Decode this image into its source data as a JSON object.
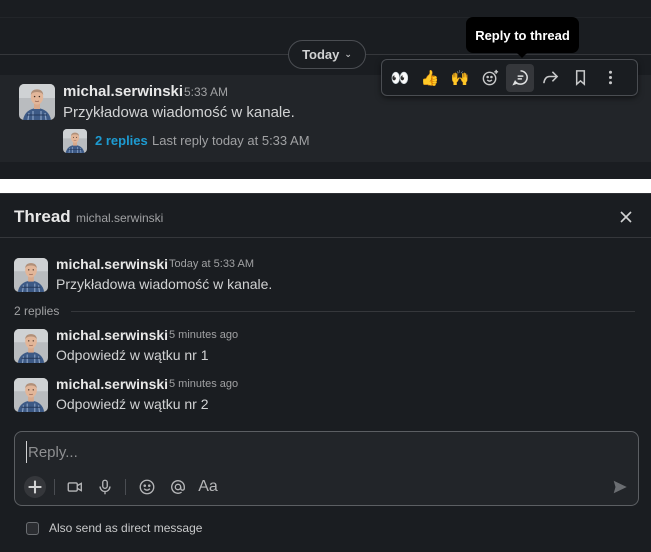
{
  "channel": {
    "date_divider": "Today",
    "message": {
      "author": "michal.serwinski",
      "time": "5:33 AM",
      "text": "Przykładowa wiadomość w kanale.",
      "replies_count": "2 replies",
      "last_reply": "Last reply today at 5:33 AM"
    },
    "tooltip": "Reply to thread",
    "actions": [
      {
        "name": "eyes-reaction",
        "glyph": "👀"
      },
      {
        "name": "thumbs-up-reaction",
        "glyph": "👍"
      },
      {
        "name": "raised-hands-reaction",
        "glyph": "🙌"
      },
      {
        "name": "add-reaction-icon"
      },
      {
        "name": "reply-in-thread-icon"
      },
      {
        "name": "share-message-icon"
      },
      {
        "name": "save-bookmark-icon"
      },
      {
        "name": "more-actions-icon"
      }
    ]
  },
  "thread": {
    "title": "Thread",
    "channel_name": "michal.serwinski",
    "parent": {
      "author": "michal.serwinski",
      "time": "Today at 5:33 AM",
      "text": "Przykładowa wiadomość w kanale."
    },
    "replies_label": "2 replies",
    "replies": [
      {
        "author": "michal.serwinski",
        "time": "5 minutes ago",
        "text": "Odpowiedź w wątku nr 1"
      },
      {
        "author": "michal.serwinski",
        "time": "5 minutes ago",
        "text": "Odpowiedź w wątku nr 2"
      }
    ],
    "composer": {
      "placeholder": "Reply...",
      "value": "",
      "format_label": "Aa"
    },
    "also_send_label": "Also send as direct message"
  },
  "colors": {
    "background": "#1a1d21",
    "hover_row": "#222529",
    "link_blue": "#1d9bd1",
    "text_primary": "#e8e8e8",
    "text_secondary": "#a0a1a3"
  }
}
